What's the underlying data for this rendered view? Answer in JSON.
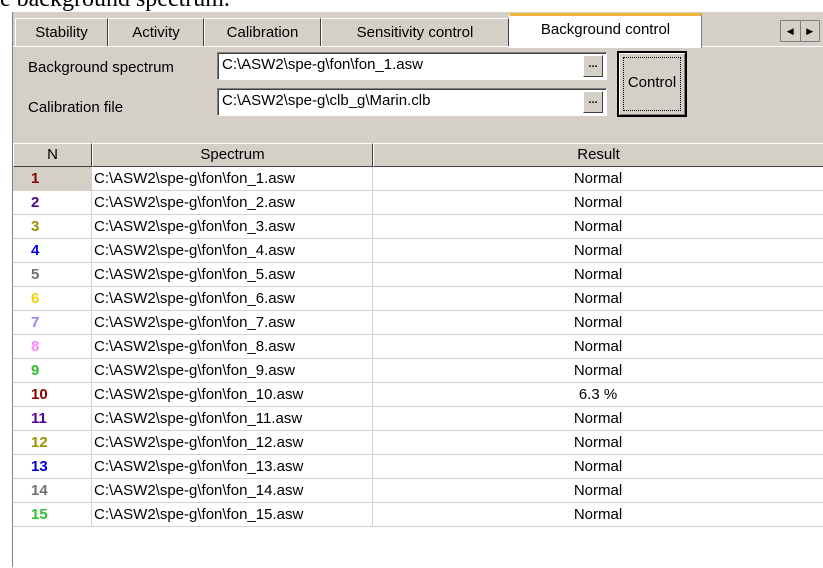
{
  "caption": "e background spectrum.",
  "tabs": [
    {
      "label": "Stability"
    },
    {
      "label": "Activity"
    },
    {
      "label": "Calibration"
    },
    {
      "label": "Sensitivity control"
    },
    {
      "label": "Background control"
    }
  ],
  "active_tab": "Background control",
  "form": {
    "background_label": "Background spectrum",
    "background_value": "C:\\ASW2\\spe-g\\fon\\fon_1.asw",
    "calibration_label": "Calibration file",
    "calibration_value": "C:\\ASW2\\spe-g\\clb_g\\Marin.clb",
    "browse_label": "...",
    "control_button": "Control"
  },
  "grid": {
    "columns": [
      "N",
      "Spectrum",
      "Result"
    ],
    "rows": [
      {
        "n": "1",
        "spectrum": "C:\\ASW2\\spe-g\\fon\\fon_1.asw",
        "result": "Normal",
        "color": "#8b0000"
      },
      {
        "n": "2",
        "spectrum": "C:\\ASW2\\spe-g\\fon\\fon_2.asw",
        "result": "Normal",
        "color": "#5a0090"
      },
      {
        "n": "3",
        "spectrum": "C:\\ASW2\\spe-g\\fon\\fon_3.asw",
        "result": "Normal",
        "color": "#9a9000"
      },
      {
        "n": "4",
        "spectrum": "C:\\ASW2\\spe-g\\fon\\fon_4.asw",
        "result": "Normal",
        "color": "#0000e0"
      },
      {
        "n": "5",
        "spectrum": "C:\\ASW2\\spe-g\\fon\\fon_5.asw",
        "result": "Normal",
        "color": "#707070"
      },
      {
        "n": "6",
        "spectrum": "C:\\ASW2\\spe-g\\fon\\fon_6.asw",
        "result": "Normal",
        "color": "#f0d000"
      },
      {
        "n": "7",
        "spectrum": "C:\\ASW2\\spe-g\\fon\\fon_7.asw",
        "result": "Normal",
        "color": "#8888ff"
      },
      {
        "n": "8",
        "spectrum": "C:\\ASW2\\spe-g\\fon\\fon_8.asw",
        "result": "Normal",
        "color": "#ff88ff"
      },
      {
        "n": "9",
        "spectrum": "C:\\ASW2\\spe-g\\fon\\fon_9.asw",
        "result": "Normal",
        "color": "#30c030"
      },
      {
        "n": "10",
        "spectrum": "C:\\ASW2\\spe-g\\fon\\fon_10.asw",
        "result": "6.3 %",
        "color": "#8b0000"
      },
      {
        "n": "11",
        "spectrum": "C:\\ASW2\\spe-g\\fon\\fon_11.asw",
        "result": "Normal",
        "color": "#5a0090"
      },
      {
        "n": "12",
        "spectrum": "C:\\ASW2\\spe-g\\fon\\fon_12.asw",
        "result": "Normal",
        "color": "#9a9000"
      },
      {
        "n": "13",
        "spectrum": "C:\\ASW2\\spe-g\\fon\\fon_13.asw",
        "result": "Normal",
        "color": "#0000e0"
      },
      {
        "n": "14",
        "spectrum": "C:\\ASW2\\spe-g\\fon\\fon_14.asw",
        "result": "Normal",
        "color": "#707070"
      },
      {
        "n": "15",
        "spectrum": "C:\\ASW2\\spe-g\\fon\\fon_15.asw",
        "result": "Normal",
        "color": "#30c030"
      }
    ]
  },
  "colors": {
    "window_face": "#d4d0c8",
    "active_tab_accent": "#f0b43c"
  },
  "icons": {
    "scroll_left": "left-arrow-icon",
    "scroll_right": "right-arrow-icon"
  }
}
